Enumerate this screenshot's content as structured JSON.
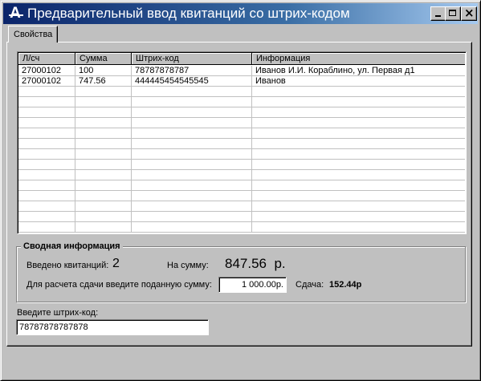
{
  "window": {
    "title": "Предварительный ввод квитанций со штрих-кодом",
    "app_icon_glyph": "A",
    "controls": {
      "min": "minimize-icon",
      "max": "maximize-icon",
      "close": "close-icon"
    }
  },
  "tabs": [
    {
      "label": "Свойства",
      "active": true
    }
  ],
  "table": {
    "columns": [
      "Л/сч",
      "Сумма",
      "Штрих-код",
      "Информация"
    ],
    "rows": [
      [
        "27000102",
        "100",
        "78787878787",
        "Иванов И.И. Кораблино, ул. Первая д1"
      ],
      [
        "27000102",
        "747.56",
        "444445454545545",
        "Иванов"
      ]
    ]
  },
  "summary": {
    "title": "Сводная информация",
    "entered_label": "Введено квитанций:",
    "entered_count": "2",
    "sum_label": "На сумму:",
    "sum_value": "847.56  р.",
    "change_prompt": "Для расчета сдачи введите поданную сумму:",
    "paid_value": "1 000.00р.",
    "change_label": "Сдача:",
    "change_value": "152.44р"
  },
  "barcode": {
    "label": "Введите штрих-код:",
    "value": "78787878787878"
  },
  "colors": {
    "titlebar_start": "#0a246a",
    "titlebar_end": "#a6caf0",
    "face": "#c0c0c0"
  }
}
